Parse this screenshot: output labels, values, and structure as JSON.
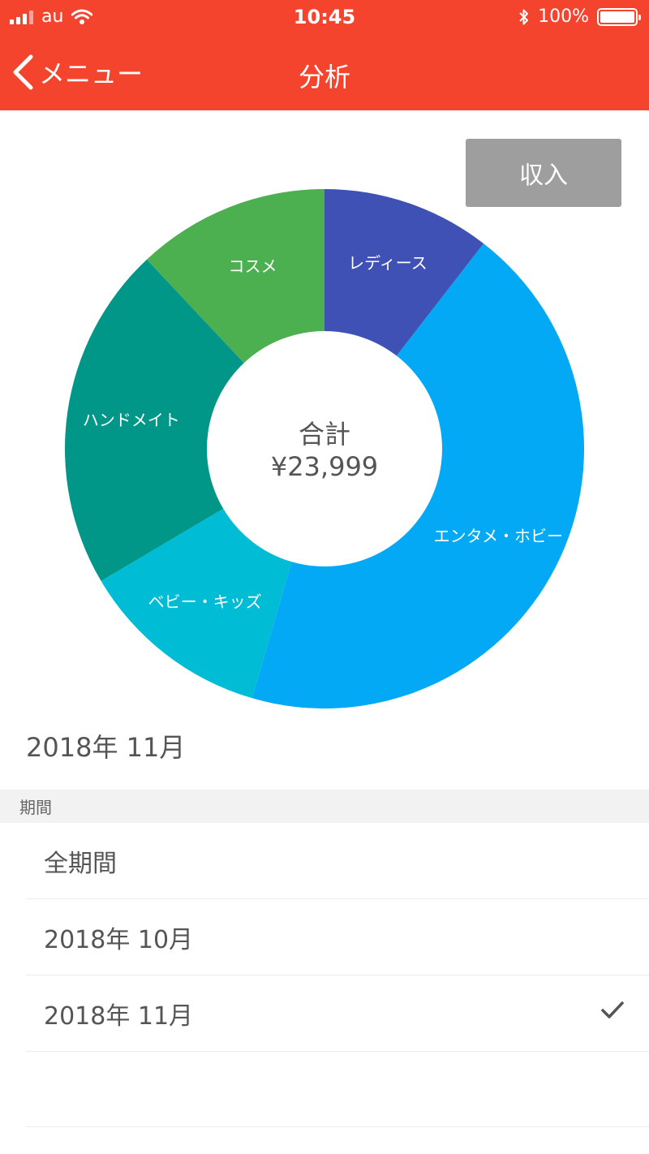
{
  "status_bar": {
    "carrier": "au",
    "time": "10:45",
    "battery": "100%"
  },
  "nav": {
    "back_label": "メニュー",
    "title": "分析"
  },
  "toggle_button": "収入",
  "chart_data": {
    "type": "pie",
    "style": "donut",
    "center_title": "合計",
    "center_value": "¥23,999",
    "slices": [
      {
        "label": "レディース",
        "share": 10.5,
        "color": "#3f51b5"
      },
      {
        "label": "エンタメ・ホビー",
        "share": 44.0,
        "color": "#03a9f4"
      },
      {
        "label": "ベビー・キッズ",
        "share": 12.0,
        "color": "#00bcd4"
      },
      {
        "label": "ハンドメイト",
        "share": 21.5,
        "color": "#009688"
      },
      {
        "label": "コスメ",
        "share": 12.0,
        "color": "#4caf50"
      }
    ]
  },
  "selected_period_label": "2018年 11月",
  "period_section": {
    "header": "期間",
    "items": [
      {
        "label": "全期間",
        "checked": false
      },
      {
        "label": "2018年 10月",
        "checked": false
      },
      {
        "label": "2018年 11月",
        "checked": true
      }
    ]
  },
  "colors": {
    "accent": "#f4442e"
  }
}
